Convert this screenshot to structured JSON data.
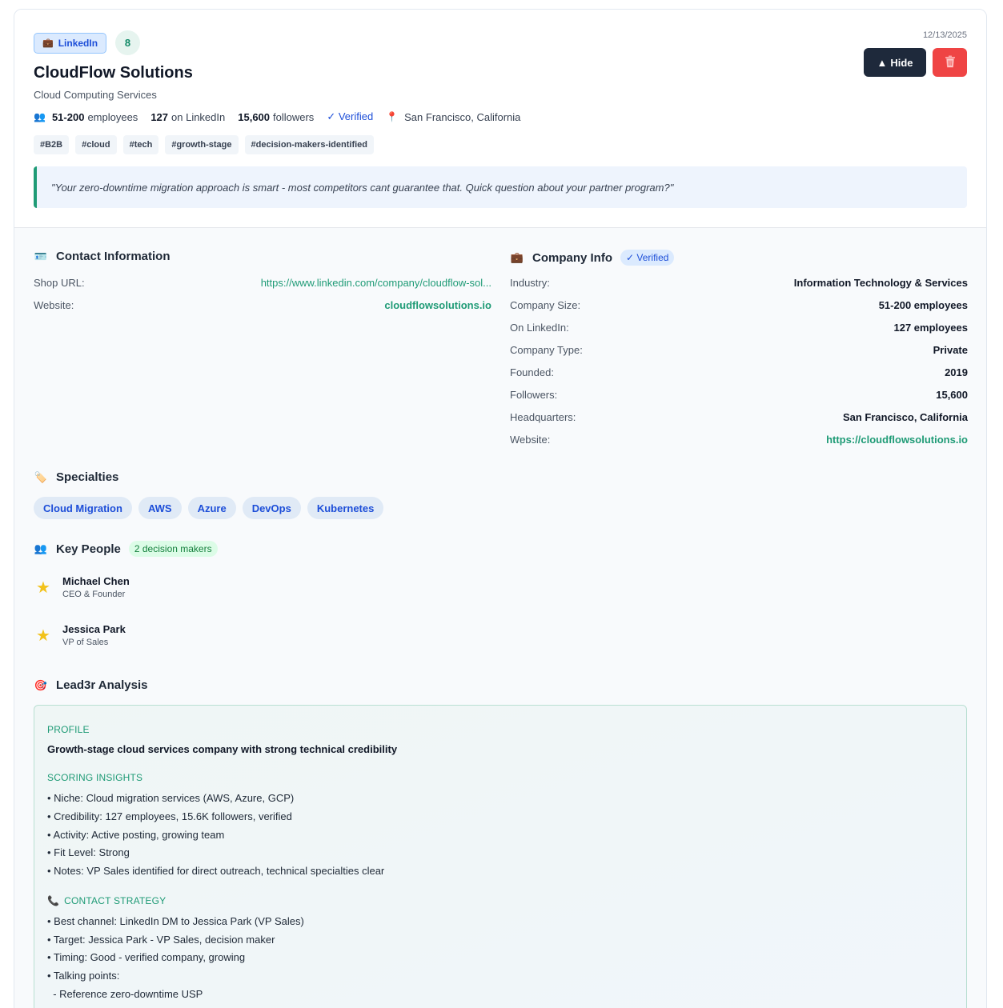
{
  "header": {
    "source_badge": "LinkedIn",
    "score": "8",
    "date": "12/13/2025",
    "company_name": "CloudFlow Solutions",
    "subtitle": "Cloud Computing Services",
    "meta": {
      "employees_value": "51-200",
      "employees_label": "employees",
      "linkedin_value": "127",
      "linkedin_label": "on LinkedIn",
      "followers_value": "15,600",
      "followers_label": "followers",
      "verified": "✓ Verified",
      "location": "San Francisco, California"
    },
    "tags": [
      "#B2B",
      "#cloud",
      "#tech",
      "#growth-stage",
      "#decision-makers-identified"
    ],
    "quote": "\"Your zero-downtime migration approach is smart - most competitors cant guarantee that. Quick question about your partner program?\"",
    "hide_label": "Hide",
    "hide_icon": "▲"
  },
  "contact": {
    "title": "Contact Information",
    "shop_url_label": "Shop URL:",
    "shop_url_value": "https://www.linkedin.com/company/cloudflow-sol...",
    "website_label": "Website:",
    "website_value": "cloudflowsolutions.io"
  },
  "company_info": {
    "title": "Company Info",
    "verified": "✓ Verified",
    "rows": [
      {
        "label": "Industry:",
        "value": "Information Technology & Services"
      },
      {
        "label": "Company Size:",
        "value": "51-200 employees"
      },
      {
        "label": "On LinkedIn:",
        "value": "127 employees"
      },
      {
        "label": "Company Type:",
        "value": "Private"
      },
      {
        "label": "Founded:",
        "value": "2019"
      },
      {
        "label": "Followers:",
        "value": "15,600"
      },
      {
        "label": "Headquarters:",
        "value": "San Francisco, California"
      },
      {
        "label": "Website:",
        "value": "https://cloudflowsolutions.io"
      }
    ]
  },
  "specialties": {
    "title": "Specialties",
    "items": [
      "Cloud Migration",
      "AWS",
      "Azure",
      "DevOps",
      "Kubernetes"
    ]
  },
  "key_people": {
    "title": "Key People",
    "badge": "2 decision makers",
    "people": [
      {
        "name": "Michael Chen",
        "role": "CEO & Founder"
      },
      {
        "name": "Jessica Park",
        "role": "VP of Sales"
      }
    ]
  },
  "analysis": {
    "title": "Lead3r Analysis",
    "profile_label": "PROFILE",
    "profile_text": "Growth-stage cloud services company with strong technical credibility",
    "insights_label": "SCORING INSIGHTS",
    "insights": [
      "• Niche: Cloud migration services (AWS, Azure, GCP)",
      "• Credibility: 127 employees, 15.6K followers, verified",
      "• Activity: Active posting, growing team",
      "• Fit Level: Strong",
      "• Notes: VP Sales identified for direct outreach, technical specialties clear"
    ],
    "strategy_label": "CONTACT STRATEGY",
    "strategy": [
      "• Best channel: LinkedIn DM to Jessica Park (VP Sales)",
      "• Target: Jessica Park - VP Sales, decision maker",
      "• Timing: Good - verified company, growing",
      "• Talking points:",
      "  - Reference zero-downtime USP"
    ]
  },
  "colors": {
    "accent": "#1f9b76",
    "link_blue": "#1d4ed8",
    "danger": "#ef4444",
    "dark_button": "#1e293b"
  }
}
